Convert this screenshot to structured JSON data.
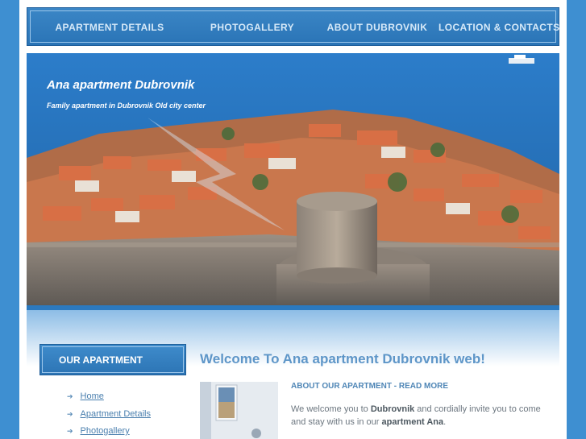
{
  "nav": {
    "items": [
      {
        "label": "APARTMENT DETAILS"
      },
      {
        "label": "PHOTOGALLERY"
      },
      {
        "label": "ABOUT DUBROVNIK"
      },
      {
        "label": "LOCATION & CONTACTS"
      }
    ]
  },
  "hero": {
    "title": "Ana apartment Dubrovnik",
    "subtitle": "Family apartment in Dubrovnik Old city center"
  },
  "sidebar": {
    "heading": "OUR APARTMENT",
    "links": [
      {
        "label": "Home"
      },
      {
        "label": "Apartment Details"
      },
      {
        "label": "Photogallery"
      }
    ]
  },
  "main": {
    "welcome": "Welcome To Ana apartment Dubrovnik web!",
    "readmore": "ABOUT OUR APARTMENT - READ MORE",
    "intro": {
      "p1": "We welcome you to ",
      "b1": "Dubrovnik",
      "p2": " and cordially invite you to come and stay with us in our ",
      "b2": "apartment Ana",
      "p3": "."
    }
  },
  "colors": {
    "background": "#3e8fd1",
    "nav": "#2a74b6",
    "accent": "#5e96c8"
  }
}
